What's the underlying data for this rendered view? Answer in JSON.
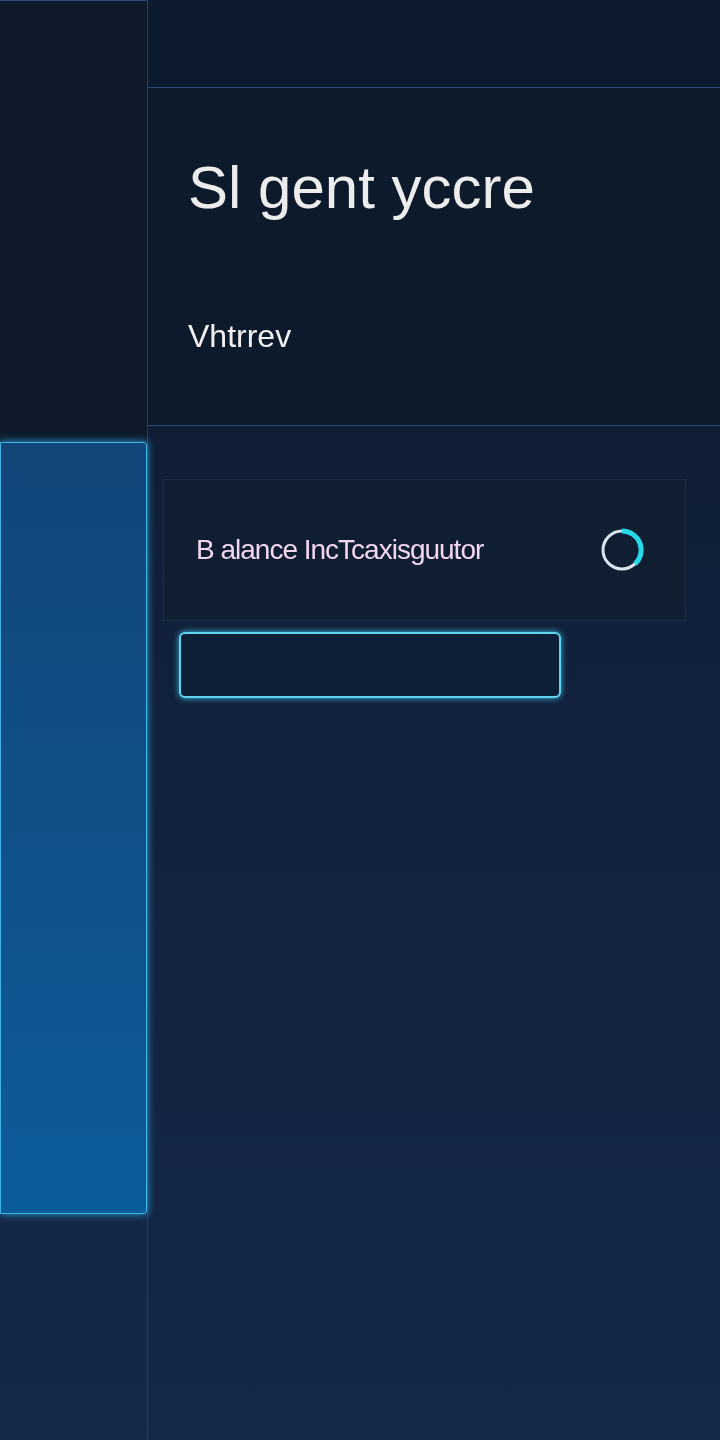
{
  "header": {
    "title": "Sl gent yccre",
    "subtitle": "Vhtrrev"
  },
  "status_card": {
    "label": "B alance IncTcaxisguutor"
  }
}
